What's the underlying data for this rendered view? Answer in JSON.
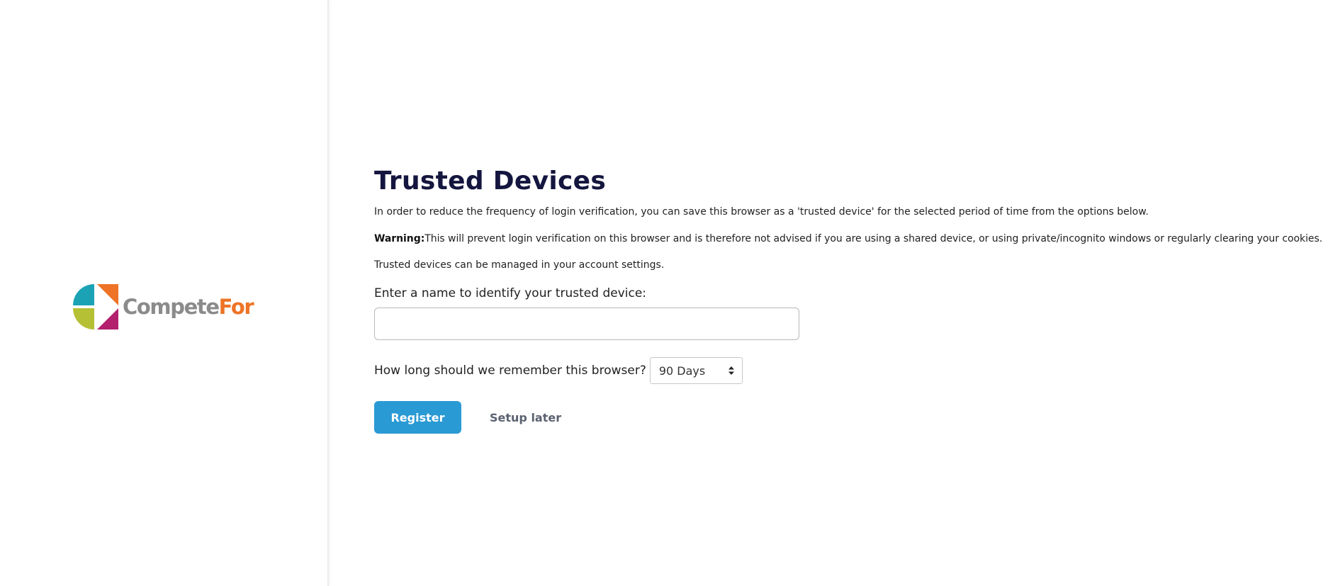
{
  "brand": {
    "logo_text_part1": "Compete",
    "logo_text_part2": "For",
    "colors": {
      "teal": "#1ba3b5",
      "orange": "#ee7326",
      "lime": "#b5c035",
      "magenta": "#b2206e",
      "grey": "#8b8b8b"
    }
  },
  "page": {
    "title": "Trusted Devices",
    "intro": "In order to reduce the frequency of login verification, you can save this browser as a 'trusted device' for the selected period of time from the options below.",
    "warning_label": "Warning:",
    "warning_text": "This will prevent login verification on this browser and is therefore not advised if you are using a shared device, or using private/incognito windows or regularly clearing your cookies.",
    "managed_note": "Trusted devices can be managed in your account settings."
  },
  "form": {
    "name_label": "Enter a name to identify your trusted device:",
    "name_value": "",
    "remember_label": "How long should we remember this browser?",
    "remember_selected": "90 Days",
    "register_label": "Register",
    "setup_later_label": "Setup later",
    "accent_color": "#2a9ad4"
  }
}
